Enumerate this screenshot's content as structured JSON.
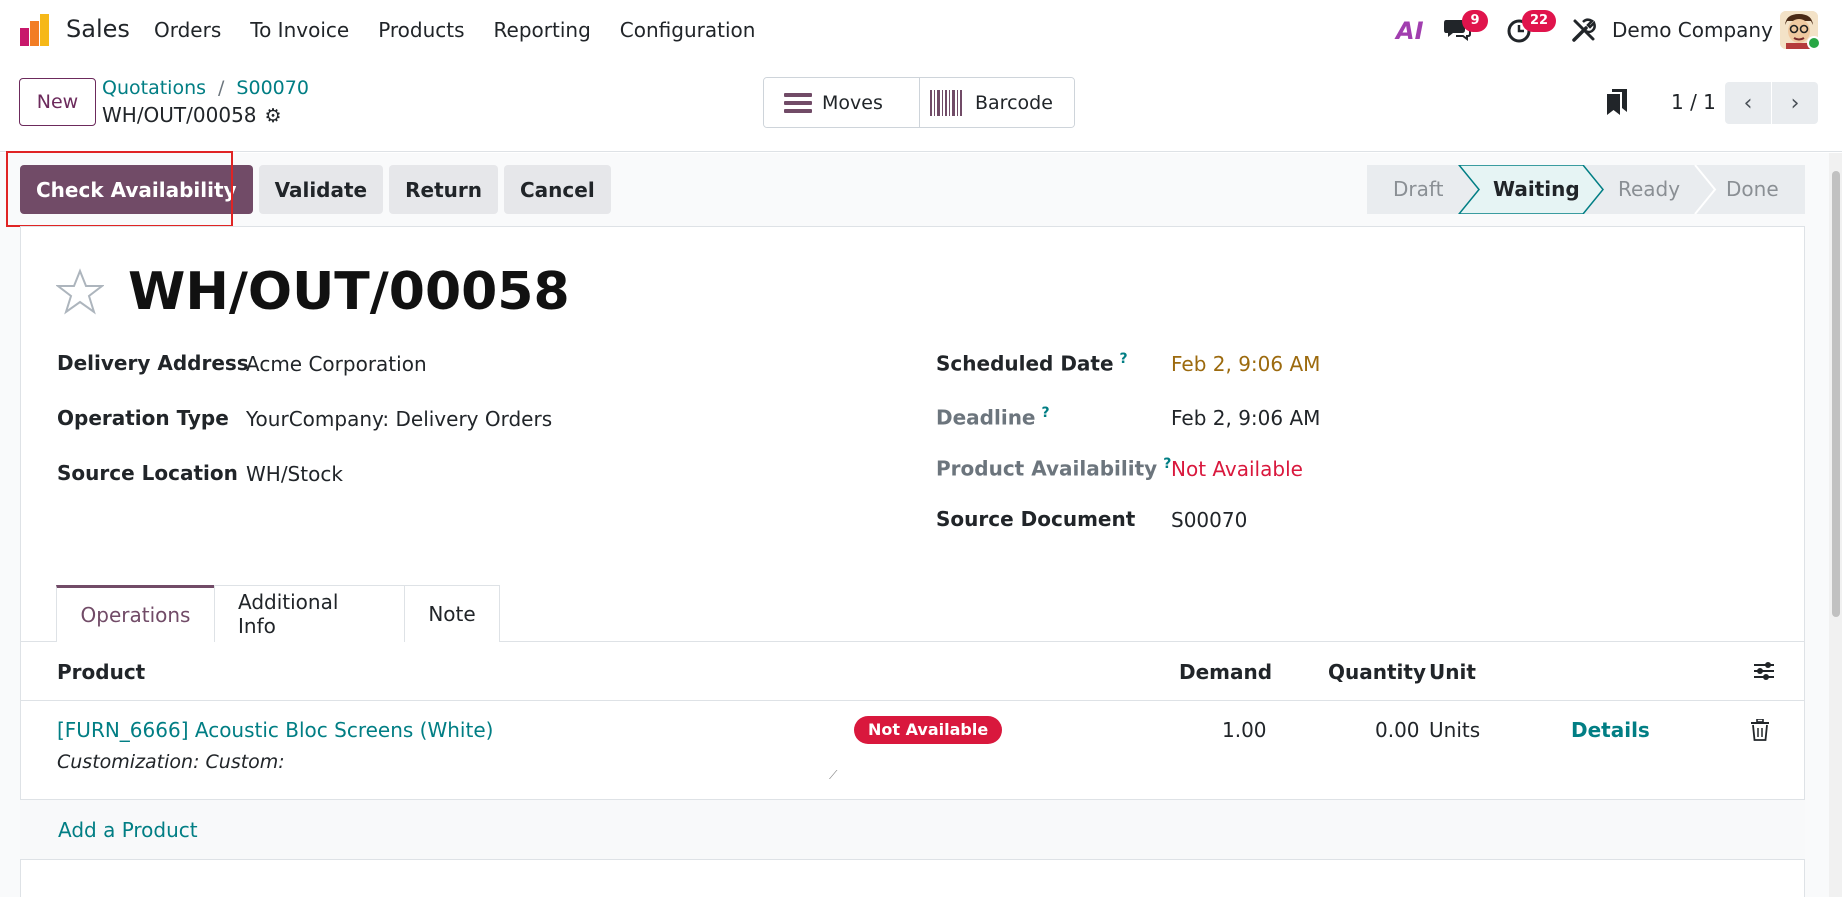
{
  "navbar": {
    "app_name": "Sales",
    "menu": [
      "Orders",
      "To Invoice",
      "Products",
      "Reporting",
      "Configuration"
    ],
    "ai_label": "AI",
    "chat_count": "9",
    "activity_count": "22",
    "company": "Demo Company"
  },
  "control": {
    "new_label": "New",
    "breadcrumb": [
      "Quotations",
      "S00070"
    ],
    "record": "WH/OUT/00058",
    "smart_buttons": [
      {
        "label": "Moves",
        "icon": "list-icon"
      },
      {
        "label": "Barcode",
        "icon": "barcode-icon"
      }
    ],
    "pager": "1 / 1"
  },
  "statusbar": {
    "buttons": [
      "Check Availability",
      "Validate",
      "Return",
      "Cancel"
    ],
    "stages": [
      "Draft",
      "Waiting",
      "Ready",
      "Done"
    ],
    "active_stage": "Waiting"
  },
  "form": {
    "title": "WH/OUT/00058",
    "left": [
      {
        "label": "Delivery Address",
        "value": "Acme Corporation"
      },
      {
        "label": "Operation Type",
        "value": "YourCompany: Delivery Orders"
      },
      {
        "label": "Source Location",
        "value": "WH/Stock"
      }
    ],
    "right": [
      {
        "label": "Scheduled Date",
        "value": "Feb 2, 9:06 AM",
        "help": "?"
      },
      {
        "label": "Deadline",
        "value": "Feb 2, 9:06 AM",
        "help": "?"
      },
      {
        "label": "Product Availability",
        "value": "Not Available",
        "help": "?"
      },
      {
        "label": "Source Document",
        "value": "S00070"
      }
    ]
  },
  "tabs": [
    "Operations",
    "Additional Info",
    "Note"
  ],
  "table": {
    "headers": {
      "product": "Product",
      "demand": "Demand",
      "quantity": "Quantity",
      "unit": "Unit"
    },
    "rows": [
      {
        "product": "[FURN_6666] Acoustic Bloc Screens (White)",
        "description": "Customization: Custom:",
        "status": "Not Available",
        "demand": "1.00",
        "quantity": "0.00",
        "unit": "Units",
        "details": "Details"
      }
    ],
    "add_label": "Add a Product"
  },
  "colors": {
    "primary": "#714b67",
    "link": "#017e84",
    "danger": "#d9183d",
    "warning": "#9c6a0e"
  }
}
